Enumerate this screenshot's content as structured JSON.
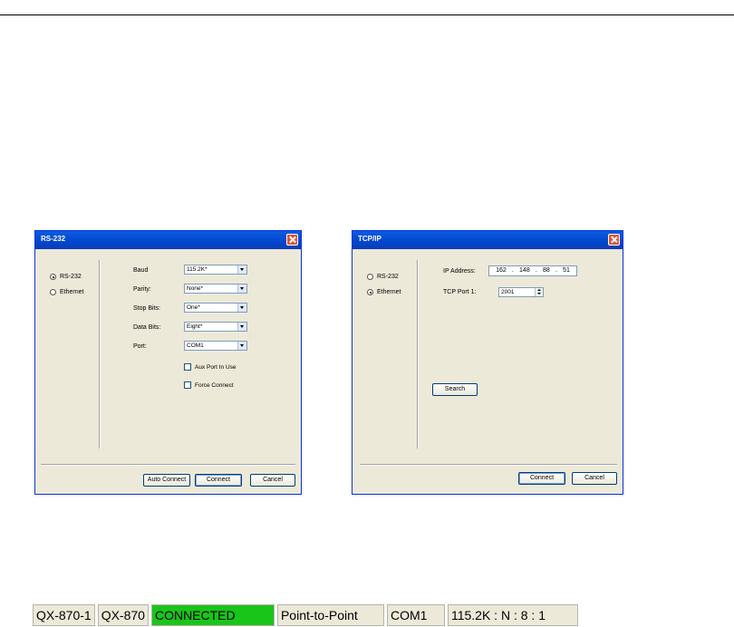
{
  "rs232_dialog": {
    "title": "RS-232",
    "radio_rs232": "RS-232",
    "radio_ethernet": "Ethernet",
    "selected": "RS-232",
    "fields": [
      {
        "label": "Baud",
        "value": "115.2K*"
      },
      {
        "label": "Parity:",
        "value": "None*"
      },
      {
        "label": "Stop Bits:",
        "value": "One*"
      },
      {
        "label": "Data Bits:",
        "value": "Eight*"
      },
      {
        "label": "Port:",
        "value": "COM1"
      }
    ],
    "aux_port_label": "Aux Port In Use",
    "force_connect_label": "Force Connect",
    "auto_connect_label": "Auto Connect",
    "connect_label": "Connect",
    "cancel_label": "Cancel"
  },
  "tcpip_dialog": {
    "title": "TCP/IP",
    "radio_rs232": "RS-232",
    "radio_ethernet": "Ethernet",
    "selected": "Ethernet",
    "ip_label": "IP Address:",
    "ip": [
      "162",
      "148",
      "88",
      "51"
    ],
    "tcp_port_label": "TCP Port 1:",
    "tcp_port_value": "2001",
    "search_label": "Search",
    "connect_label": "Connect",
    "cancel_label": "Cancel"
  },
  "status_bar": {
    "device_name": "QX-870-1",
    "model": "QX-870",
    "status": "CONNECTED",
    "mode": "Point-to-Point",
    "port": "COM1",
    "settings": "115.2K : N : 8 : 1",
    "status_color": "#19c519"
  }
}
